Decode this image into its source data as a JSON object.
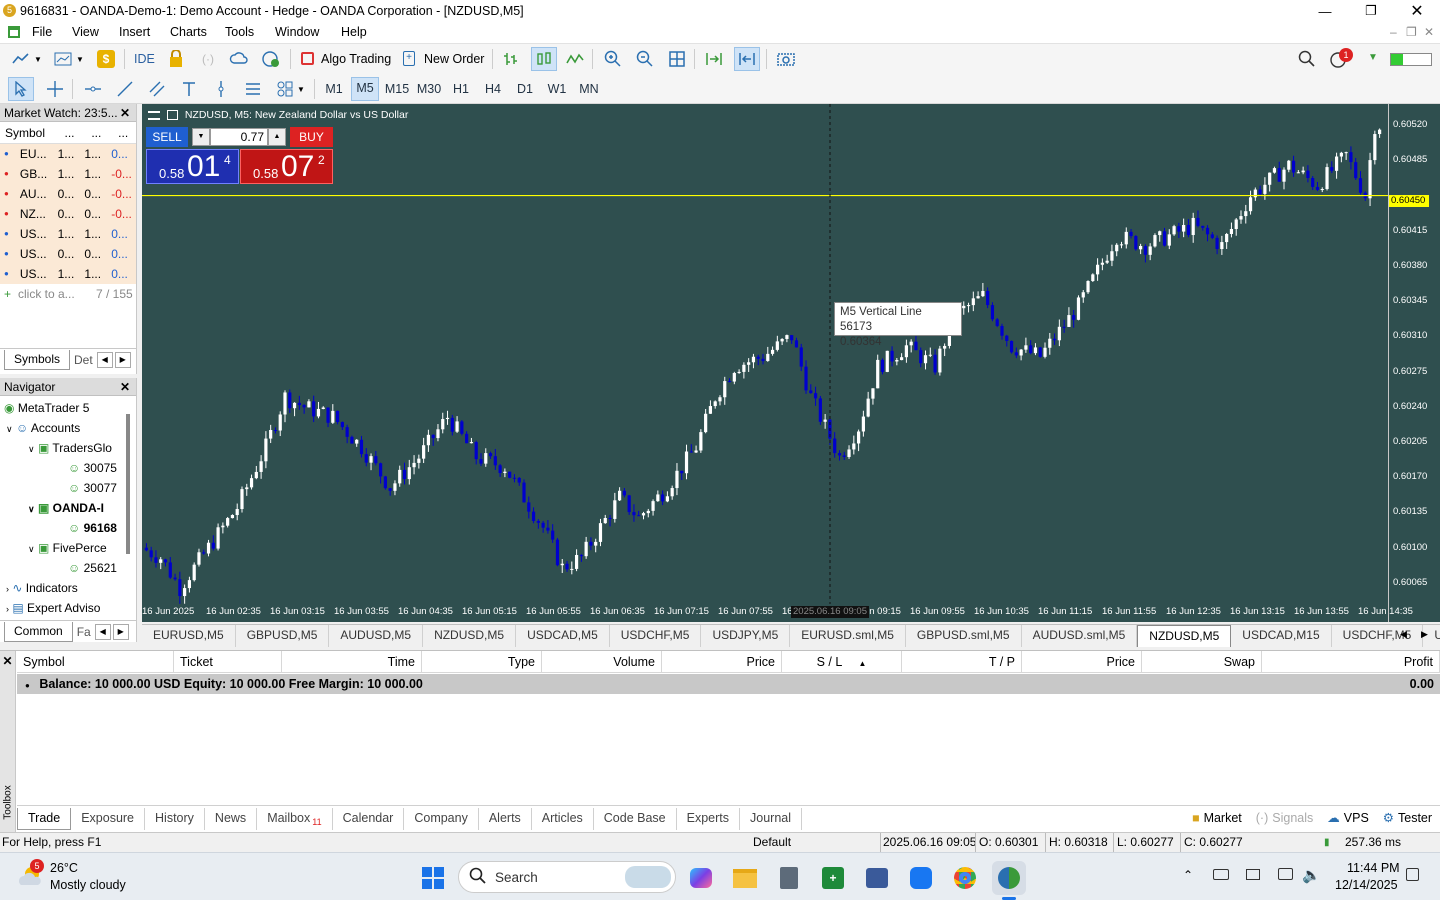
{
  "window": {
    "title": "9616831 - OANDA-Demo-1: Demo Account - Hedge - OANDA Corporation - [NZDUSD,M5]"
  },
  "menu": [
    "File",
    "View",
    "Insert",
    "Charts",
    "Tools",
    "Window",
    "Help"
  ],
  "toolbar": {
    "ide": "IDE",
    "algo": "Algo Trading",
    "new_order": "New Order",
    "notif_count": "1"
  },
  "timeframes": [
    "M1",
    "M5",
    "M15",
    "M30",
    "H1",
    "H4",
    "D1",
    "W1",
    "MN"
  ],
  "timeframe_selected": "M5",
  "market_watch": {
    "title": "Market Watch: 23:5...",
    "headers": [
      "Symbol",
      "...",
      "...",
      "..."
    ],
    "rows": [
      {
        "s": "EU...",
        "b": "1...",
        "a": "1...",
        "c": "0...",
        "up": true
      },
      {
        "s": "GB...",
        "b": "1...",
        "a": "1...",
        "c": "-0...",
        "up": false
      },
      {
        "s": "AU...",
        "b": "0...",
        "a": "0...",
        "c": "-0...",
        "up": false
      },
      {
        "s": "NZ...",
        "b": "0...",
        "a": "0...",
        "c": "-0...",
        "up": false
      },
      {
        "s": "US...",
        "b": "1...",
        "a": "1...",
        "c": "0...",
        "up": true
      },
      {
        "s": "US...",
        "b": "0...",
        "a": "0...",
        "c": "0...",
        "up": true
      },
      {
        "s": "US...",
        "b": "1...",
        "a": "1...",
        "c": "0...",
        "up": true
      }
    ],
    "add_text": "click to a...",
    "count": "7 / 155",
    "tabs": [
      "Symbols",
      "Det"
    ]
  },
  "navigator": {
    "title": "Navigator",
    "items": [
      "MetaTrader 5",
      "Accounts",
      "TradersGlo",
      "30075",
      "30077",
      "OANDA-I",
      "96168",
      "FivePerce",
      "25621",
      "Indicators",
      "Expert Adviso"
    ],
    "tabs": [
      "Common",
      "Fa"
    ]
  },
  "chart": {
    "label": "NZDUSD, M5:  New Zealand Dollar vs US Dollar",
    "sell": "SELL",
    "buy": "BUY",
    "lot": "0.77",
    "bid_small": "0.58",
    "bid_big": "01",
    "bid_sup": "4",
    "ask_small": "0.58",
    "ask_big": "07",
    "ask_sup": "2",
    "tooltip_name": "M5 Vertical Line 56173",
    "tooltip_price": "0.60364",
    "hline_label": "0.60450",
    "vline_time_label": "2025.06.16 09:05",
    "price_ticks": [
      "0.60520",
      "0.60485",
      "0.60415",
      "0.60380",
      "0.60345",
      "0.60310",
      "0.60275",
      "0.60240",
      "0.60205",
      "0.60170",
      "0.60135",
      "0.60100",
      "0.60065"
    ],
    "time_ticks": [
      "16 Jun 2025",
      "16 Jun 02:35",
      "16 Jun 03:15",
      "16 Jun 03:55",
      "16 Jun 04:35",
      "16 Jun 05:15",
      "16 Jun 05:55",
      "16 Jun 06:35",
      "16 Jun 07:15",
      "16 Jun 07:55",
      "16 ",
      "16 Jun 09:15",
      "16 Jun 09:55",
      "16 Jun 10:35",
      "16 Jun 11:15",
      "16 Jun 11:55",
      "16 Jun 12:35",
      "16 Jun 13:15",
      "16 Jun 13:55",
      "16 Jun 14:35"
    ],
    "colors": {
      "bg": "#2f4f4f",
      "bull": "#ffffff",
      "bear": "#0000cd",
      "hline": "#ffff00"
    }
  },
  "chart_tabs": [
    "EURUSD,M5",
    "GBPUSD,M5",
    "AUDUSD,M5",
    "NZDUSD,M5",
    "USDCAD,M5",
    "USDCHF,M5",
    "USDJPY,M5",
    "EURUSD.sml,M5",
    "GBPUSD.sml,M5",
    "AUDUSD.sml,M5",
    "NZDUSD,M5",
    "USDCAD,M15",
    "USDCHF,M5",
    "US"
  ],
  "chart_tab_active": 10,
  "trade": {
    "headers": [
      "Symbol",
      "Ticket",
      "Time",
      "Type",
      "Volume",
      "Price",
      "S / L",
      "T / P",
      "Price",
      "Swap",
      "Profit"
    ],
    "balance": "Balance: 10 000.00 USD  Equity: 10 000.00  Free Margin: 10 000.00",
    "profit": "0.00",
    "tabs": [
      "Trade",
      "Exposure",
      "History",
      "News",
      "Mailbox",
      "Calendar",
      "Company",
      "Alerts",
      "Articles",
      "Code Base",
      "Experts",
      "Journal"
    ],
    "mailbox_count": "11",
    "right_items": [
      "Market",
      "Signals",
      "VPS",
      "Tester"
    ],
    "toolbox_label": "Toolbox"
  },
  "status": {
    "help": "For Help, press F1",
    "profile": "Default",
    "time": "2025.06.16 09:05",
    "o": "O: 0.60301",
    "h": "H: 0.60318",
    "l": "L: 0.60277",
    "c": "C: 0.60277",
    "ping": "257.36 ms"
  },
  "taskbar": {
    "weather_badge": "5",
    "temp": "26°C",
    "weather": "Mostly cloudy",
    "search": "Search",
    "time": "11:44 PM",
    "date": "12/14/2025"
  }
}
